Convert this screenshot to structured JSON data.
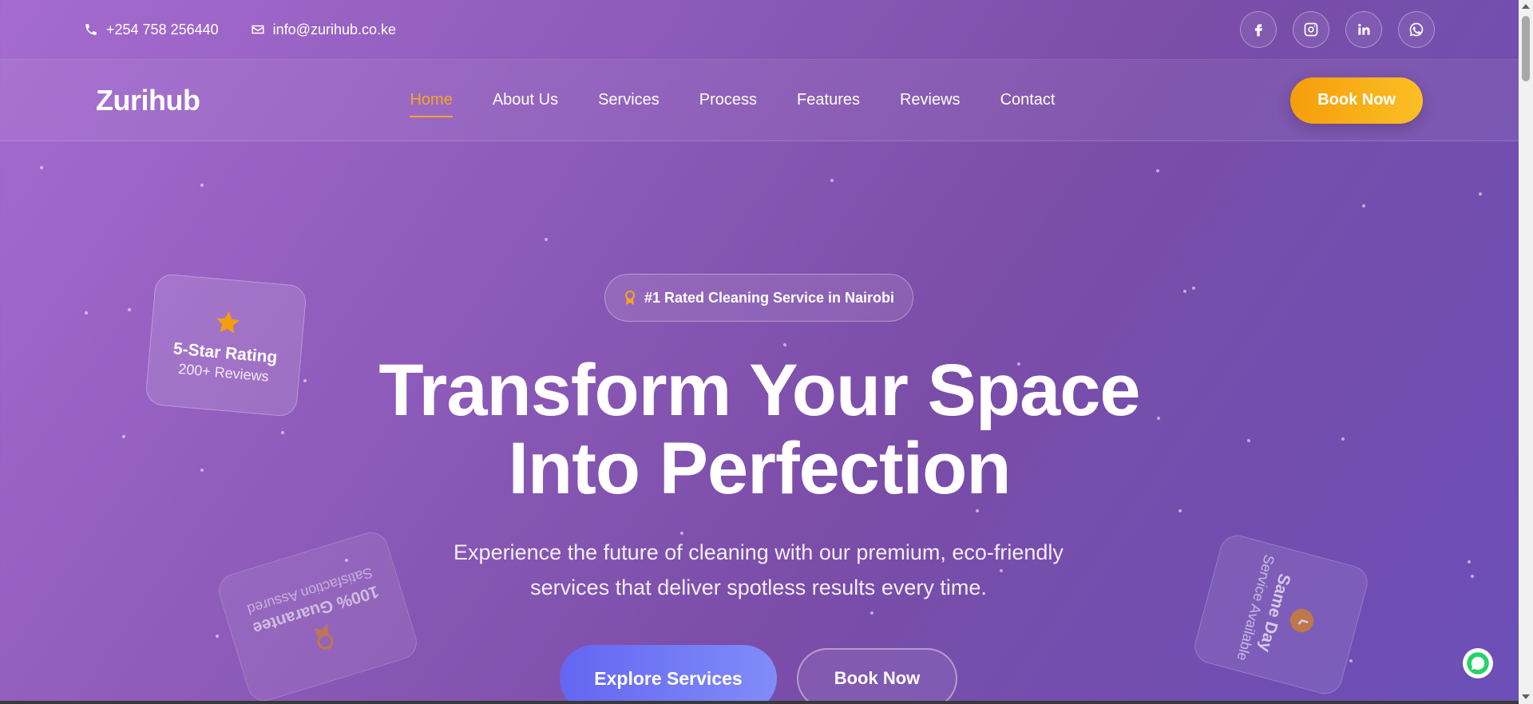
{
  "topbar": {
    "phone": "+254 758 256440",
    "email": "info@zurihub.co.ke",
    "social_icons": [
      "facebook-icon",
      "instagram-icon",
      "linkedin-icon",
      "whatsapp-icon"
    ]
  },
  "nav": {
    "logo": "Zurihub",
    "links": [
      "Home",
      "About Us",
      "Services",
      "Process",
      "Features",
      "Reviews",
      "Contact"
    ],
    "active": "Home",
    "cta": "Book Now"
  },
  "hero": {
    "badge": "#1 Rated Cleaning Service in Nairobi",
    "headline_line1": "Transform Your Space",
    "headline_line2": "Into Perfection",
    "subtext": "Experience the future of cleaning with our premium, eco-friendly services that deliver spotless results every time.",
    "primary_button": "Explore Services",
    "secondary_button": "Book Now"
  },
  "floating_cards": {
    "rating": {
      "title": "5-Star Rating",
      "subtitle": "200+ Reviews",
      "icon": "star-icon"
    },
    "guarantee": {
      "title": "100% Guarantee",
      "subtitle": "Satisfaction Assured",
      "icon": "award-icon"
    },
    "same_day": {
      "title": "Same Day",
      "subtitle": "Service Available",
      "icon": "clock-icon"
    }
  },
  "colors": {
    "accent": "#f6a623",
    "primary_button": "#6366f1",
    "whatsapp": "#25d366"
  }
}
